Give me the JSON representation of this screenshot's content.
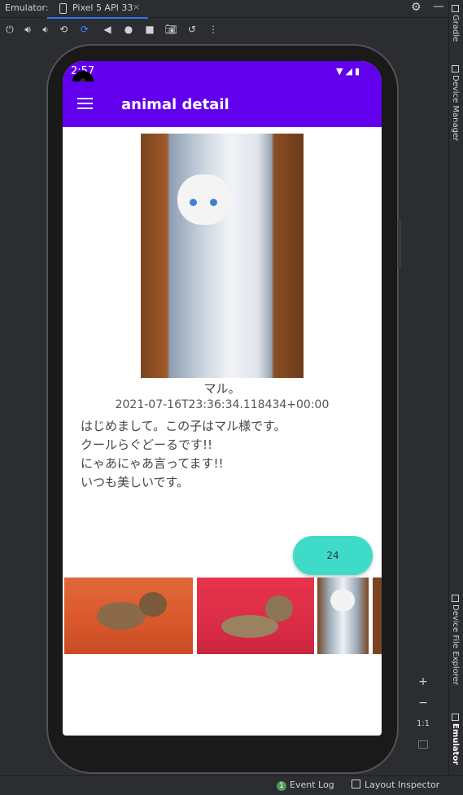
{
  "ide": {
    "emulator_label": "Emulator:",
    "device_tab": "Pixel 5 API 33",
    "tab_close": "×",
    "right_tabs": [
      "Gradle",
      "Device Manager",
      "Device File Explorer",
      "Emulator"
    ],
    "zoom_in": "+",
    "zoom_out": "−",
    "zoom_reset": "1:1",
    "event_log_count": "1",
    "event_log": "Event Log",
    "layout_inspector": "Layout Inspector"
  },
  "phone": {
    "status_time": "2:57",
    "app_title": "animal detail",
    "animal_name": "マル。",
    "created_at": "2021-07-16T23:36:34.118434+00:00",
    "description_lines": [
      "はじめまして。この子はマル様です。",
      "クールらぐどーるです!!",
      "にゃあにゃあ言ってます!!",
      "いつも美しいです。"
    ],
    "like_count": "24"
  }
}
